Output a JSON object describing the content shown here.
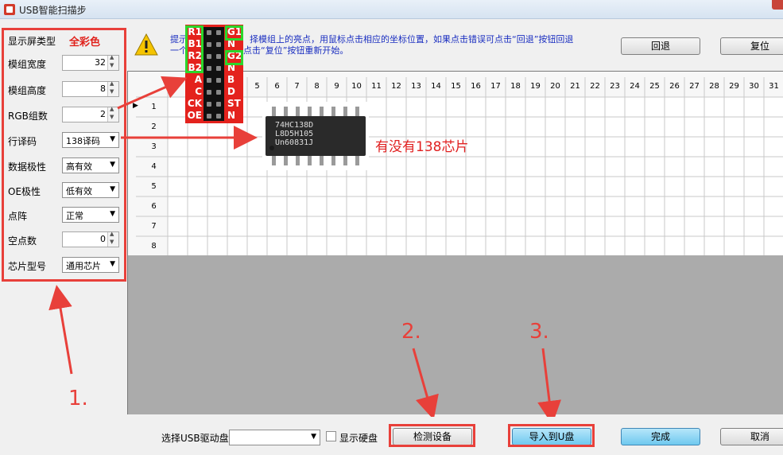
{
  "window": {
    "title": "USB智能扫描步"
  },
  "left_panel": {
    "screen_type": {
      "label": "显示屏类型",
      "value": "全彩色"
    },
    "module_width": {
      "label": "模组宽度",
      "value": "32"
    },
    "module_height": {
      "label": "模组高度",
      "value": "8"
    },
    "rgb_groups": {
      "label": "RGB组数",
      "value": "2"
    },
    "row_decode": {
      "label": "行译码",
      "value": "138译码"
    },
    "data_polarity": {
      "label": "数据极性",
      "value": "高有效"
    },
    "oe_polarity": {
      "label": "OE极性",
      "value": "低有效"
    },
    "dot_matrix": {
      "label": "点阵",
      "value": "正常"
    },
    "empty_dots": {
      "label": "空点数",
      "value": "0"
    },
    "chip_model": {
      "label": "芯片型号",
      "value": "通用芯片"
    }
  },
  "tip": {
    "line1_start": "提示",
    "line1_end": "择模组上的亮点，用鼠标点击相应的坐标位置，如果点击错误可点击“回退”按钮回退",
    "line2_start": "一个",
    "line2_end": "点击“复位”按钮重新开始。",
    "back_button": "回退",
    "reset_button": "复位"
  },
  "grid": {
    "column_headers": [
      "5",
      "6",
      "7",
      "8",
      "9",
      "10",
      "11",
      "12",
      "13",
      "14",
      "15",
      "16",
      "17",
      "18",
      "19",
      "20",
      "21",
      "22",
      "23",
      "24",
      "25",
      "26",
      "27",
      "28",
      "29",
      "30",
      "31"
    ],
    "row_headers": [
      "1",
      "2",
      "3",
      "4",
      "5",
      "6",
      "7",
      "8"
    ]
  },
  "pinout": {
    "left_pins": [
      "R1",
      "B1",
      "R2",
      "B2",
      "A",
      "C",
      "CK",
      "OE"
    ],
    "right_pins": [
      "G1",
      "N",
      "G2",
      "N",
      "B",
      "D",
      "ST",
      "N"
    ]
  },
  "ic_photo": {
    "line1": "74HC138D",
    "line2": "L8D5H105",
    "line3": "Un60831J"
  },
  "annotation": {
    "chip_question": "有没有138芯片",
    "step1": "1.",
    "step2": "2.",
    "step3": "3."
  },
  "bottom": {
    "usb_label": "选择USB驱动盘",
    "usb_value": "",
    "show_disk_label": "显示硬盘",
    "detect_button": "检测设备",
    "import_button": "导入到U盘",
    "finish_button": "完成",
    "cancel_button": "取消"
  },
  "colors": {
    "annotation_red": "#e8403a",
    "tip_blue": "#1a2ec0",
    "pin_highlight_green": "#2bd62b",
    "pin_board_red": "#e4221d"
  }
}
